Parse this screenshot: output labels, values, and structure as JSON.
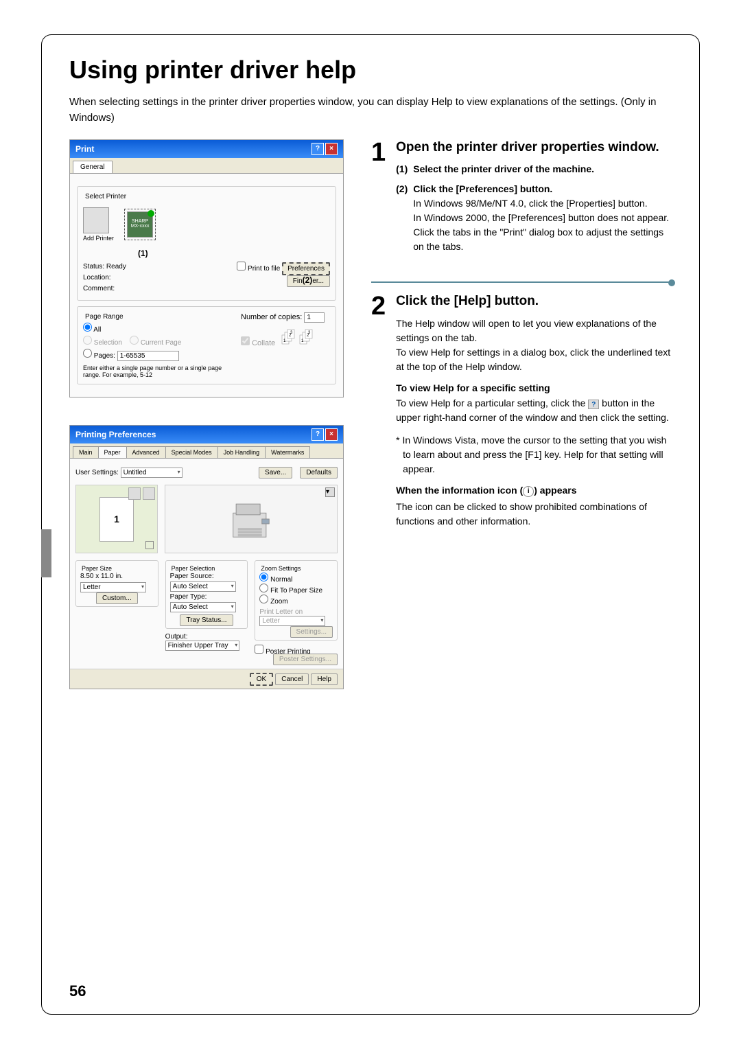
{
  "page": {
    "title": "Using printer driver help",
    "subtitle": "When selecting settings in the printer driver properties window, you can display Help to view explanations of the settings. (Only in Windows)",
    "page_number": "56"
  },
  "dialog1": {
    "title": "Print",
    "tab_general": "General",
    "fieldset_select_printer": "Select Printer",
    "add_printer": "Add Printer",
    "sharp_label": "SHARP",
    "sharp_model": "MX-xxxx",
    "annotation_1": "(1)",
    "status_label": "Status:",
    "status_val": "Ready",
    "location_label": "Location:",
    "comment_label": "Comment:",
    "print_to_file": "Print to file",
    "preferences_btn": "Preferences",
    "find_printer_btn": "Fin",
    "annotation_2": "(2)",
    "find_printer_suffix": "er...",
    "fieldset_page_range": "Page Range",
    "radio_all": "All",
    "radio_selection": "Selection",
    "radio_current": "Current Page",
    "radio_pages": "Pages:",
    "pages_value": "1-65535",
    "pages_hint": "Enter either a single page number or a single page range. For example, 5-12",
    "copies_label": "Number of copies:",
    "copies_value": "1",
    "collate_label": "Collate"
  },
  "dialog2": {
    "title": "Printing Preferences",
    "tabs": {
      "main": "Main",
      "paper": "Paper",
      "advanced": "Advanced",
      "special_modes": "Special Modes",
      "job_handling": "Job Handling",
      "watermarks": "Watermarks"
    },
    "user_settings_label": "User Settings:",
    "user_settings_val": "Untitled",
    "save_btn": "Save...",
    "defaults_btn": "Defaults",
    "preview_num": "1",
    "paper_size_label": "Paper Size",
    "paper_size_dim": "8.50 x 11.0 in.",
    "paper_size_val": "Letter",
    "custom_btn": "Custom...",
    "paper_selection_label": "Paper Selection",
    "paper_source_label": "Paper Source:",
    "paper_source_val": "Auto Select",
    "paper_type_label": "Paper Type:",
    "paper_type_val": "Auto Select",
    "tray_status_btn": "Tray Status...",
    "output_label": "Output:",
    "output_val": "Finisher Upper Tray",
    "zoom_settings_label": "Zoom Settings",
    "zoom_normal": "Normal",
    "zoom_fit": "Fit To Paper Size",
    "zoom_zoom": "Zoom",
    "print_letter_label": "Print Letter on",
    "print_letter_val": "Letter",
    "settings_btn": "Settings...",
    "poster_printing": "Poster Printing",
    "poster_settings_btn": "Poster Settings...",
    "ok_btn": "OK",
    "cancel_btn": "Cancel",
    "help_btn": "Help"
  },
  "step1": {
    "num": "1",
    "title": "Open the printer driver properties window.",
    "sub1_num": "(1)",
    "sub1_title": "Select the printer driver of the machine.",
    "sub2_num": "(2)",
    "sub2_title": "Click the [Preferences] button.",
    "sub2_body": "In Windows 98/Me/NT 4.0, click the [Properties] button.\nIn Windows 2000, the [Preferences] button does not appear. Click the tabs in the \"Print\" dialog box to adjust the settings on the tabs."
  },
  "step2": {
    "num": "2",
    "title": "Click the [Help] button.",
    "body1": "The Help window will open to let you view explanations of the settings on the tab.\nTo view Help for settings in a dialog box, click the underlined text at the top of the Help window.",
    "heading2": "To view Help for a specific setting",
    "body2a": "To view Help for a particular setting, click the ",
    "body2b": " button in the upper right-hand corner of the window and then click the setting.",
    "body2c": "* In Windows Vista, move the cursor to the setting that you wish to learn about and press the [F1] key. Help for that setting will appear.",
    "heading3": "When the information icon (",
    "heading3b": ") appears",
    "body3": "The icon can be clicked to show prohibited combinations of functions and other information."
  }
}
